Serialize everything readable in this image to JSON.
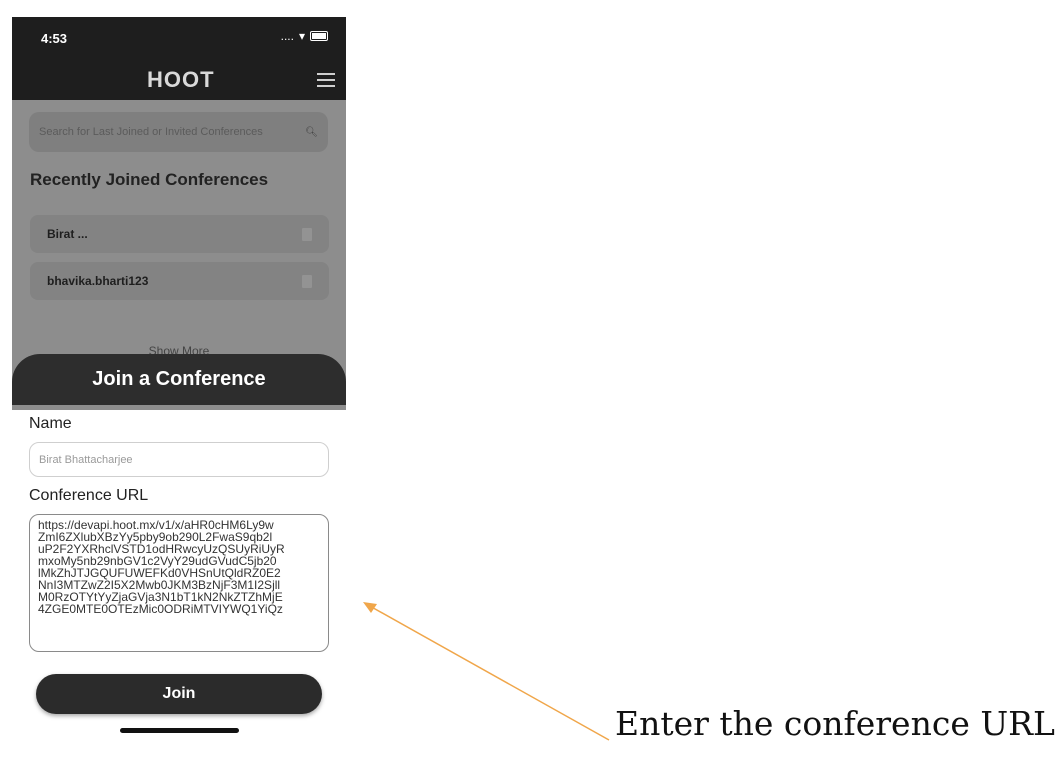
{
  "status_bar": {
    "time": "4:53",
    "signal": "....",
    "wifi_icon": "wifi-icon",
    "battery_icon": "battery-icon"
  },
  "nav": {
    "logo_text": "HOOT",
    "menu_icon": "hamburger-menu-icon"
  },
  "search": {
    "placeholder": "Search for Last Joined or Invited Conferences",
    "icon": "search-icon"
  },
  "recent": {
    "title": "Recently Joined Conferences",
    "items": [
      {
        "name": "Birat ..."
      },
      {
        "name": "bhavika.bharti123"
      }
    ],
    "show_more": "Show More"
  },
  "sheet": {
    "title": "Join a Conference",
    "name_label": "Name",
    "name_value": "Birat Bhattacharjee",
    "url_label": "Conference URL",
    "url_lines": [
      "https://devapi.hoot.mx/v1/x/aHR0cHM6Ly9w",
      "ZmI6ZXlubXBzYy5pby9ob290L2FwaS9qb2l",
      "uP2F2YXRhclVSTD1odHRwcyUzQSUyRiUyR",
      "mxoMy5nb29nbGV1c2VyY29udGVudC5jb20",
      "lMkZhJTJGQUFUWEFKd0VHSnUtQldRZ0E2",
      "NnI3MTZwZ2I5X2Mwb0JKM3BzNjF3M1I2Sjll",
      "M0RzOTYtYyZjaGVja3N1bT1kN2NkZTZhMjE",
      "4ZGE0MTE0OTEzMic0ODRiMTVIYWQ1YiQz"
    ],
    "join_label": "Join"
  },
  "annotation": {
    "text": "Enter the conference URL",
    "color": "#f0a64a"
  }
}
